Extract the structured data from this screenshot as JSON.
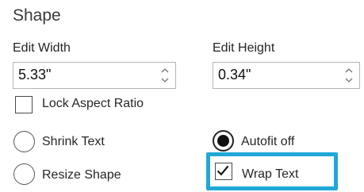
{
  "panel": {
    "title": "Shape",
    "width": {
      "label": "Edit Width",
      "value": "5.33\""
    },
    "height": {
      "label": "Edit Height",
      "value": "0.34\""
    },
    "lock_aspect": {
      "label": "Lock Aspect Ratio",
      "checked": false
    },
    "autofit_options": [
      {
        "label": "Shrink Text",
        "selected": false
      },
      {
        "label": "Autofit off",
        "selected": true
      },
      {
        "label": "Resize Shape",
        "selected": false
      }
    ],
    "wrap_text": {
      "label": "Wrap Text",
      "checked": true
    },
    "highlight_color": "#1fa8d6"
  }
}
